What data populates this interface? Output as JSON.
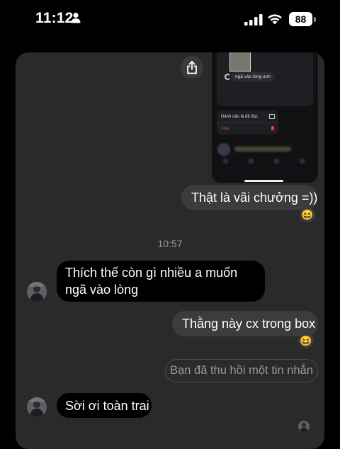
{
  "status_bar": {
    "time": "11:12",
    "battery": "88",
    "icons": [
      "person-icon",
      "signal-icon",
      "wifi-icon",
      "battery-icon"
    ]
  },
  "shared_image": {
    "pill_text": "ngã vào lòng anh",
    "menu_mark_read": "Đánh dấu là đã đọc",
    "menu_delete": "Xóa",
    "share_icon": "share-icon"
  },
  "messages": [
    {
      "id": "m1",
      "side": "out",
      "text": "Thật là vãi chưởng =))",
      "reaction": "😆"
    },
    {
      "id": "m2",
      "side": "in",
      "text": "Thích thế còn gì nhiều a muốn ngã vào lòng"
    },
    {
      "id": "m3",
      "side": "out",
      "text": "Thằng này cx trong box",
      "reaction": "😆"
    },
    {
      "id": "m4",
      "side": "out",
      "recalled": true,
      "text": "Bạn đã thu hồi một tin nhắn"
    },
    {
      "id": "m5",
      "side": "in",
      "text": "Sời ơi toàn trai"
    }
  ],
  "timestamp": "10:57",
  "colors": {
    "background": "#000000",
    "sheet": "#2a2a2b",
    "outgoing_bubble": "#3c3c3e",
    "incoming_bubble": "#000000",
    "muted_text": "#9a9a9c",
    "delete_red": "#e0453a"
  }
}
